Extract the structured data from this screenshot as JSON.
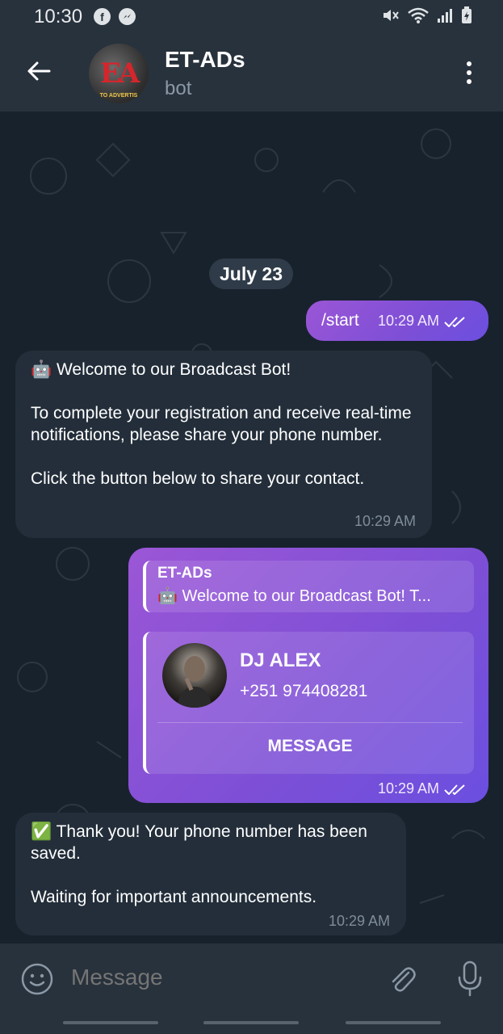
{
  "status_bar": {
    "time": "10:30",
    "app_icons": [
      "facebook-icon",
      "messenger-icon"
    ],
    "system_icons": [
      "mute-icon",
      "wifi-icon",
      "signal-icon",
      "battery-icon"
    ]
  },
  "header": {
    "title": "ET-ADs",
    "subtitle": "bot",
    "avatar_text": "EA",
    "avatar_subtext": "TO ADVERTIS",
    "back_icon": "arrow-left-icon",
    "menu_icon": "more-vertical-icon"
  },
  "chat": {
    "date": "July 23",
    "messages": [
      {
        "type": "outgoing",
        "text": "/start",
        "time": "10:29 AM",
        "status": "read"
      },
      {
        "type": "incoming",
        "text": "🤖 Welcome to our Broadcast Bot!\n\nTo complete your registration and receive real-time notifications, please share your phone number.\n\nClick the button below to share your contact.",
        "time": "10:29 AM"
      },
      {
        "type": "outgoing-contact",
        "reply_name": "ET-ADs",
        "reply_text": "🤖 Welcome to our Broadcast Bot!  T...",
        "contact_name": "DJ ALEX",
        "contact_phone": "+251 974408281",
        "contact_action": "MESSAGE",
        "time": "10:29 AM",
        "status": "read"
      },
      {
        "type": "incoming",
        "text": "✅ Thank you! Your phone number has been saved.\n\nWaiting for important announcements.",
        "time": "10:29 AM"
      }
    ]
  },
  "input": {
    "placeholder": "Message",
    "emoji_icon": "emoji-icon",
    "attach_icon": "paperclip-icon",
    "mic_icon": "microphone-icon"
  },
  "colors": {
    "header_bg": "#28323c",
    "chat_bg": "#18222d",
    "incoming_bubble": "#232e3a",
    "outgoing_bubble": "#8a52d8"
  }
}
